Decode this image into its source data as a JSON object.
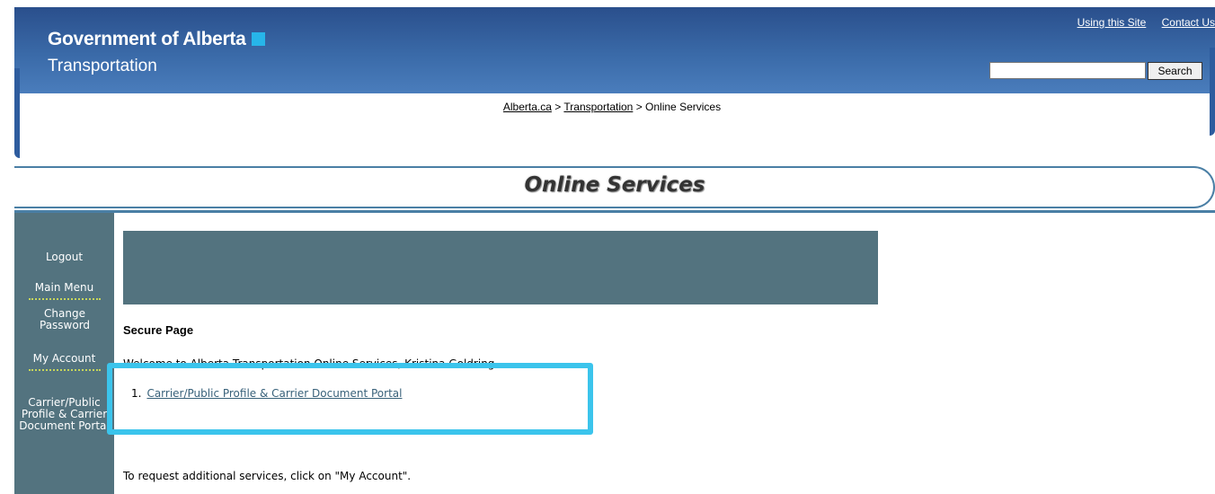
{
  "header": {
    "org_name": "Government of Alberta",
    "dept_name": "Transportation",
    "accent_color": "#27b5e9",
    "util_links": [
      "Using this Site",
      "Contact Us"
    ],
    "search": {
      "value": "",
      "button_label": "Search"
    }
  },
  "breadcrumb": {
    "items": [
      "Alberta.ca",
      "Transportation",
      "Online Services"
    ],
    "separator": ">"
  },
  "page_title": "Online Services",
  "sidebar": {
    "items": [
      {
        "label": "Logout"
      },
      {
        "label": "Main Menu"
      },
      {
        "label": "Change Password"
      },
      {
        "label": "My Account"
      },
      {
        "label": "Carrier/Public Profile & Carrier Document Portal"
      }
    ]
  },
  "main": {
    "secure_label": "Secure Page",
    "welcome_text": "Welcome to Alberta Transportation Online Services, Kristina Goldring.",
    "services": [
      {
        "number": "1.",
        "label": "Carrier/Public Profile & Carrier Document Portal"
      }
    ],
    "request_text": "To request additional services, click on \"My Account\"."
  },
  "colors": {
    "header_blue": "#2a4f8c",
    "sidebar": "#53737f",
    "highlight": "#3bc4ec"
  }
}
